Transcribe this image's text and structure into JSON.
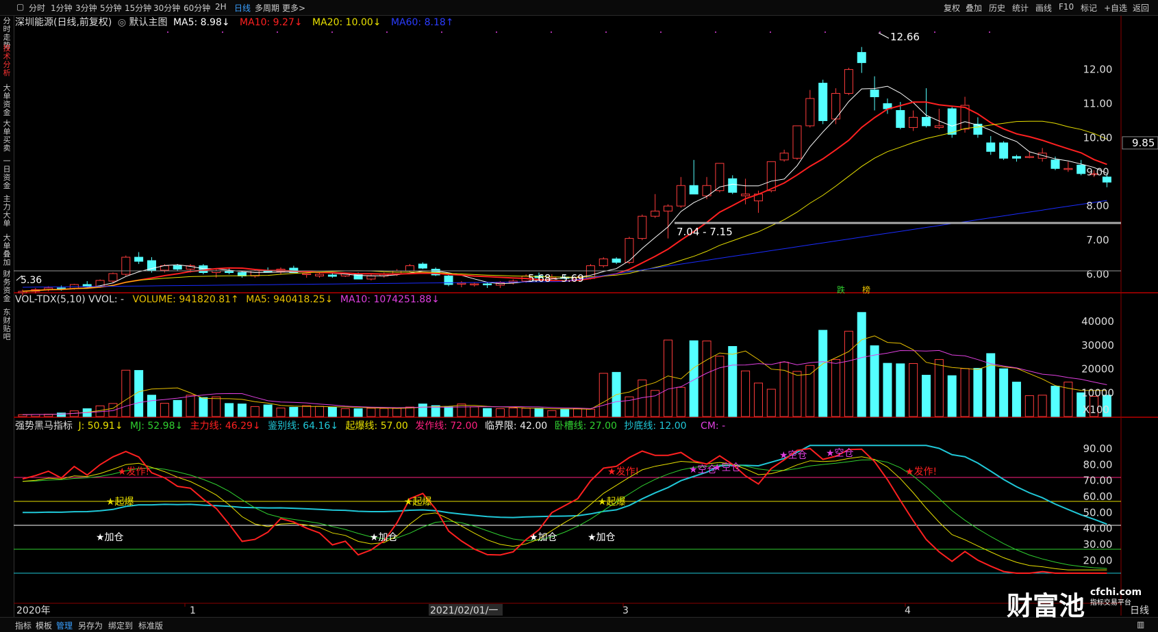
{
  "toolbar": {
    "left": [
      "分时",
      "1分钟",
      "3分钟",
      "5分钟",
      "15分钟",
      "30分钟",
      "60分钟",
      "2H",
      "日线",
      "多周期",
      "更多>"
    ],
    "active": "日线",
    "right": [
      "复权",
      "叠加",
      "历史",
      "统计",
      "画线",
      "F10",
      "标记",
      "+自选",
      "返回"
    ]
  },
  "sidenav": [
    "分时走势",
    "技术分析",
    "大单资金",
    "大单买卖",
    "一日资金",
    "主力大单",
    "大单叠加",
    "财务资金",
    "东财贴吧"
  ],
  "sidenav_active": "技术分析",
  "main_legend": {
    "stock": "深圳能源(日线,前复权)",
    "sep": "◎",
    "chart_label": "默认主图",
    "ma5": "MA5: 8.98↓",
    "ma10": "MA10: 9.27↓",
    "ma20": "MA20: 10.00↓",
    "ma60": "MA60: 8.18↑",
    "ma5_color": "#ffffff",
    "ma10_color": "#ff2020",
    "ma20_color": "#e8e000",
    "ma60_color": "#1a2cff"
  },
  "vol_legend": {
    "name": "VOL-TDX(5,10) VVOL: -",
    "volume": "VOLUME: 941820.81↑",
    "ma5": "MA5: 940418.25↓",
    "ma10": "MA10: 1074251.88↓"
  },
  "ind_legend": {
    "name": "强势黑马指标",
    "j": "J: 50.91↓",
    "mj": "MJ: 52.98↓",
    "zl": "主力线: 46.29↓",
    "jb": "鉴别线: 64.16↓",
    "qb": "起爆线: 57.00",
    "fz": "发作线: 72.00",
    "lj": "临界限: 42.00",
    "wc": "卧槽线: 27.00",
    "cd": "抄底线: 12.00",
    "cm": "CM: -"
  },
  "price_axis": [
    "12.00",
    "11.00",
    "10.00",
    "9.00",
    "8.00",
    "7.00",
    "6.00"
  ],
  "price_current": "9.85",
  "vol_axis": [
    "40000",
    "30000",
    "20000",
    "10000"
  ],
  "vol_unit": "X100",
  "ind_axis": [
    "90.00",
    "80.00",
    "70.00",
    "60.00",
    "50.00",
    "40.00",
    "30.00",
    "20.00"
  ],
  "annotations": {
    "high": "12.66",
    "low_left": "5.36",
    "support": "7.04 - 7.15",
    "mid": "5.68 - 5.69",
    "tag1": "跌",
    "tag2": "榜"
  },
  "signals": {
    "jiacang": "★加仓",
    "qibao": "★起爆",
    "fazuo": "★发作!",
    "kongcang": "★空仓"
  },
  "dates": {
    "start": "2020年",
    "m1": "1",
    "cursor": "2021/02/01/一",
    "m3": "3",
    "m4": "4",
    "end": "日线"
  },
  "bottom_tabs": [
    "指标",
    "模板",
    "管理",
    "另存为",
    "绑定到",
    "标准版"
  ],
  "bottom_active": "管理",
  "watermark": {
    "brand": "财富池",
    "site": "cfchi.com",
    "slogan": "指标交易平台"
  },
  "candles": [
    [
      5.46,
      5.55,
      5.38,
      5.5
    ],
    [
      5.5,
      5.6,
      5.44,
      5.55
    ],
    [
      5.55,
      5.65,
      5.5,
      5.6
    ],
    [
      5.6,
      5.67,
      5.52,
      5.56
    ],
    [
      5.58,
      5.72,
      5.55,
      5.7
    ],
    [
      5.7,
      5.8,
      5.62,
      5.64
    ],
    [
      5.65,
      5.85,
      5.6,
      5.82
    ],
    [
      5.8,
      6.05,
      5.75,
      6.02
    ],
    [
      6.0,
      6.55,
      5.95,
      6.5
    ],
    [
      6.5,
      6.65,
      6.3,
      6.38
    ],
    [
      6.4,
      6.5,
      6.05,
      6.12
    ],
    [
      6.12,
      6.3,
      6.05,
      6.25
    ],
    [
      6.25,
      6.3,
      6.1,
      6.15
    ],
    [
      6.15,
      6.3,
      6.05,
      6.25
    ],
    [
      6.25,
      6.3,
      6.0,
      6.05
    ],
    [
      6.05,
      6.15,
      5.9,
      6.1
    ],
    [
      6.1,
      6.2,
      6.0,
      6.05
    ],
    [
      6.05,
      6.1,
      5.9,
      5.95
    ],
    [
      5.95,
      6.15,
      5.9,
      6.1
    ],
    [
      6.1,
      6.2,
      6.05,
      6.08
    ],
    [
      6.08,
      6.2,
      6.0,
      6.15
    ],
    [
      6.18,
      6.25,
      6.05,
      6.05
    ],
    [
      6.0,
      6.05,
      5.9,
      6.02
    ],
    [
      5.95,
      6.05,
      5.9,
      6.0
    ],
    [
      5.98,
      6.05,
      5.9,
      5.94
    ],
    [
      5.95,
      6.05,
      5.92,
      6.02
    ],
    [
      6.0,
      6.05,
      5.85,
      5.86
    ],
    [
      5.86,
      6.0,
      5.82,
      5.95
    ],
    [
      5.95,
      6.05,
      5.9,
      6.0
    ],
    [
      6.0,
      6.15,
      5.95,
      6.1
    ],
    [
      6.1,
      6.3,
      6.05,
      6.25
    ],
    [
      6.3,
      6.35,
      6.15,
      6.18
    ],
    [
      6.15,
      6.2,
      5.95,
      5.98
    ],
    [
      5.95,
      6.0,
      5.65,
      5.7
    ],
    [
      5.72,
      5.8,
      5.62,
      5.74
    ],
    [
      5.7,
      5.75,
      5.64,
      5.72
    ],
    [
      5.72,
      5.78,
      5.6,
      5.7
    ],
    [
      5.68,
      5.8,
      5.6,
      5.75
    ],
    [
      5.75,
      5.85,
      5.7,
      5.8
    ],
    [
      5.8,
      6.0,
      5.75,
      5.95
    ],
    [
      5.95,
      6.05,
      5.85,
      5.9
    ],
    [
      5.92,
      6.0,
      5.85,
      5.92
    ],
    [
      5.92,
      5.98,
      5.85,
      5.88
    ],
    [
      5.85,
      5.95,
      5.8,
      5.9
    ],
    [
      5.88,
      6.3,
      5.85,
      6.25
    ],
    [
      6.25,
      6.5,
      6.2,
      6.45
    ],
    [
      6.45,
      6.5,
      6.3,
      6.35
    ],
    [
      6.35,
      7.1,
      6.3,
      7.05
    ],
    [
      7.05,
      7.75,
      7.0,
      7.7
    ],
    [
      7.7,
      8.35,
      7.65,
      7.85
    ],
    [
      7.85,
      8.05,
      7.05,
      8.0
    ],
    [
      8.0,
      8.85,
      7.95,
      8.6
    ],
    [
      8.6,
      9.35,
      8.5,
      8.35
    ],
    [
      8.3,
      8.85,
      8.2,
      8.6
    ],
    [
      8.45,
      9.25,
      8.4,
      9.25
    ],
    [
      8.8,
      8.9,
      8.35,
      8.4
    ],
    [
      8.3,
      8.8,
      8.05,
      8.35
    ],
    [
      8.15,
      8.45,
      7.8,
      8.35
    ],
    [
      8.45,
      9.3,
      8.4,
      9.3
    ],
    [
      9.35,
      9.65,
      9.3,
      9.55
    ],
    [
      9.4,
      10.3,
      9.35,
      10.35
    ],
    [
      10.35,
      11.4,
      10.3,
      11.15
    ],
    [
      11.6,
      11.7,
      10.4,
      10.5
    ],
    [
      10.55,
      11.45,
      10.4,
      11.3
    ],
    [
      11.3,
      12.05,
      11.25,
      12.0
    ],
    [
      12.5,
      12.66,
      11.9,
      12.2
    ],
    [
      11.4,
      11.8,
      10.8,
      11.2
    ],
    [
      11.0,
      11.15,
      10.7,
      10.85
    ],
    [
      10.8,
      11.05,
      10.25,
      10.3
    ],
    [
      10.3,
      10.8,
      10.2,
      10.6
    ],
    [
      10.6,
      11.45,
      10.3,
      10.35
    ],
    [
      10.3,
      10.85,
      10.25,
      10.35
    ],
    [
      10.85,
      10.9,
      10.0,
      10.1
    ],
    [
      10.25,
      11.2,
      10.15,
      10.95
    ],
    [
      10.4,
      10.6,
      10.0,
      10.1
    ],
    [
      9.85,
      10.05,
      9.5,
      9.6
    ],
    [
      9.85,
      9.9,
      9.35,
      9.4
    ],
    [
      9.45,
      9.5,
      9.3,
      9.4
    ],
    [
      9.45,
      9.6,
      9.4,
      9.45
    ],
    [
      9.4,
      9.7,
      9.3,
      9.55
    ],
    [
      9.35,
      9.45,
      9.05,
      9.1
    ],
    [
      9.1,
      9.3,
      9.0,
      9.1
    ],
    [
      9.2,
      9.35,
      8.9,
      8.95
    ],
    [
      8.95,
      9.05,
      8.85,
      8.95
    ],
    [
      8.85,
      8.95,
      8.55,
      8.7
    ]
  ],
  "volume": [
    800,
    900,
    1000,
    1500,
    2400,
    3300,
    4500,
    5500,
    19500,
    19400,
    9000,
    5600,
    6800,
    9000,
    8000,
    8300,
    5500,
    5300,
    4200,
    4900,
    3600,
    3900,
    4600,
    4300,
    4000,
    3300,
    3300,
    3500,
    3400,
    3600,
    4000,
    5300,
    4600,
    4100,
    5300,
    4100,
    3400,
    3300,
    3600,
    3500,
    3500,
    2500,
    3000,
    3400,
    3100,
    18200,
    18600,
    8300,
    15400,
    11000,
    32200,
    12300,
    31900,
    31800,
    25400,
    29500,
    19200,
    14100,
    11500,
    22900,
    19000,
    21500,
    36300,
    24000,
    35900,
    43800,
    29800,
    22400,
    22200,
    22300,
    17400,
    24000,
    17200,
    20200,
    20300,
    26500,
    20100,
    14500,
    8800,
    9000,
    12800,
    14500,
    10000,
    8500,
    9000
  ]
}
